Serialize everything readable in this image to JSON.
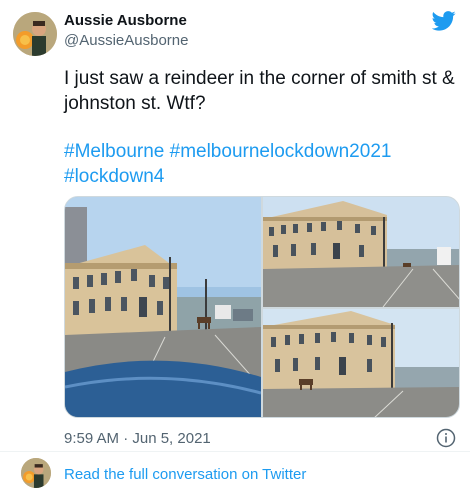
{
  "tweet": {
    "author": {
      "display_name": "Aussie Ausborne",
      "handle": "@AussieAusborne"
    },
    "text": "I just saw a reindeer in the corner of smith st & johnston st. Wtf?",
    "hashtags": [
      "#Melbourne",
      "#melbournelockdown2021",
      "#lockdown4"
    ],
    "timestamp": "9:59 AM · Jun 5, 2021"
  },
  "footer": {
    "link_label": "Read the full conversation on Twitter"
  },
  "icons": {
    "logo": "twitter-bird-icon",
    "info": "info-icon"
  },
  "colors": {
    "brand": "#1d9bf0",
    "text": "#0f1419",
    "secondary": "#536471"
  }
}
